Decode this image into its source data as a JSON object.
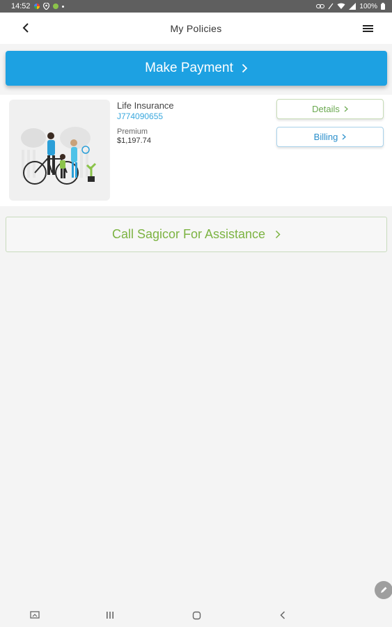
{
  "status_bar": {
    "time": "14:52",
    "battery": "100%"
  },
  "app_bar": {
    "title": "My Policies"
  },
  "payment": {
    "label": "Make Payment"
  },
  "policy": {
    "type": "Life Insurance",
    "number": "J774090655",
    "premium_label": "Premium",
    "premium_value": "$1,197.74",
    "details_label": "Details",
    "billing_label": "Billing"
  },
  "assistance": {
    "label": "Call Sagicor For Assistance"
  },
  "colors": {
    "primary_blue": "#1da1e2",
    "accent_green": "#7cb342",
    "link_blue": "#3aa8de",
    "status_bar_bg": "#5f5f5f"
  },
  "icons": [
    "back-arrow-icon",
    "hamburger-menu-icon",
    "chevron-right-icon",
    "edit-pencil-icon",
    "nav-recents-icon",
    "nav-home-icon",
    "nav-back-icon",
    "nav-screenshot-icon"
  ]
}
